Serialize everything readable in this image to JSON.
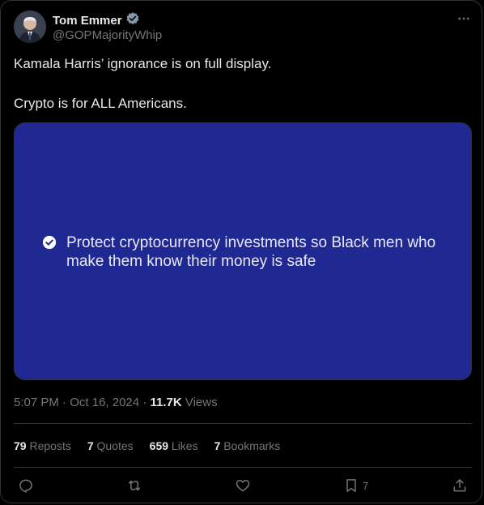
{
  "author": {
    "name": "Tom Emmer",
    "handle": "@GOPMajorityWhip"
  },
  "tweet": {
    "line1": "Kamala Harris’ ignorance is on full display.",
    "line2": "Crypto is for ALL Americans."
  },
  "media": {
    "text": "Protect cryptocurrency investments so Black men who make them know their money is safe",
    "background": "#202891"
  },
  "meta": {
    "time": "5:07 PM",
    "sep1": " · ",
    "date": "Oct 16, 2024",
    "sep2": " · ",
    "views_count": "11.7K",
    "views_label": " Views"
  },
  "stats": {
    "reposts_count": "79",
    "reposts_label": "Reposts",
    "quotes_count": "7",
    "quotes_label": "Quotes",
    "likes_count": "659",
    "likes_label": "Likes",
    "bookmarks_count": "7",
    "bookmarks_label": "Bookmarks"
  },
  "actions": {
    "reply": "reply-icon",
    "repost": "repost-icon",
    "like": "heart-icon",
    "bookmark": "bookmark-icon",
    "bookmark_count": "7",
    "share": "share-icon"
  },
  "colors": {
    "verified": "#829aab",
    "muted": "#71767b",
    "text": "#e7e9ea"
  }
}
